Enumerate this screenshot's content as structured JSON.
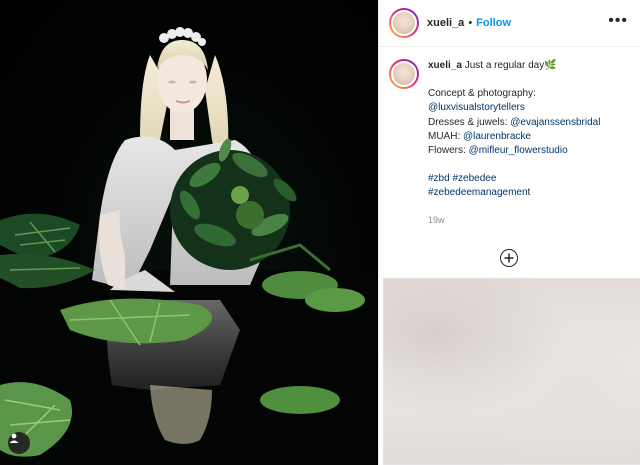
{
  "post": {
    "username": "xueli_a",
    "separator": "•",
    "follow_label": "Follow",
    "more_icon": "more-horizontal-icon",
    "caption": {
      "username": "xueli_a",
      "line1": " Just a regular day",
      "emoji": "🌿",
      "credits_title": "Concept & photography:",
      "photo_handle": "@luxvisualstorytellers",
      "dresses_label": "Dresses & juwels: ",
      "dresses_handle": "@evajanssensbridal",
      "muah_label": "MUAH: ",
      "muah_handle": "@laurenbracke",
      "flowers_label": "Flowers: ",
      "flowers_handle": "@mifleur_flowerstudio",
      "hashtag1": "#zbd",
      "hashtag2": "#zebedee",
      "hashtag3": "#zebedeemanagement"
    },
    "age": "19w",
    "load_more_icon": "plus-circle-icon",
    "tag_icon": "user-tag-icon"
  },
  "colors": {
    "link": "#00376b",
    "follow": "#0095f6",
    "text": "#262626",
    "muted": "#8e8e8e"
  }
}
